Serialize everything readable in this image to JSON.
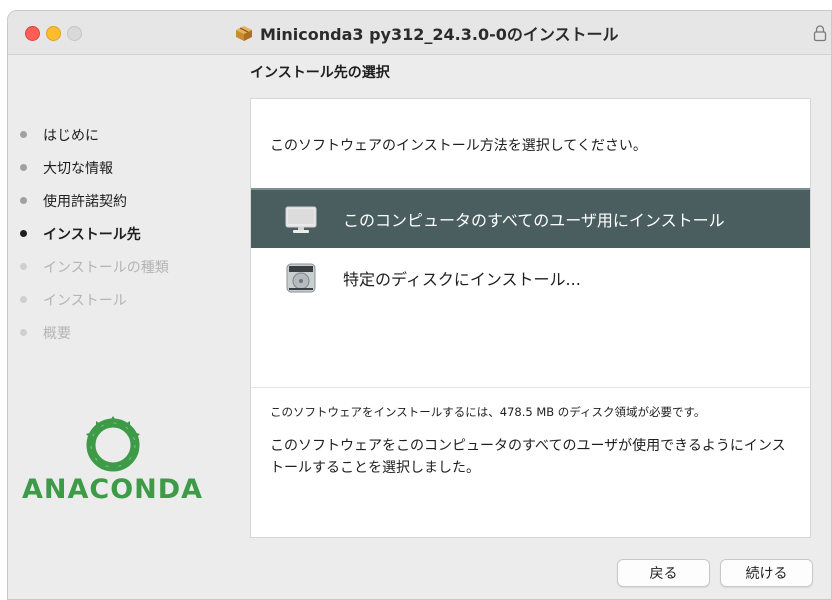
{
  "window": {
    "title": "Miniconda3 py312_24.3.0-0のインストール"
  },
  "section_heading": "インストール先の選択",
  "sidebar": {
    "steps": [
      {
        "label": "はじめに",
        "state": "done"
      },
      {
        "label": "大切な情報",
        "state": "done"
      },
      {
        "label": "使用許諾契約",
        "state": "done"
      },
      {
        "label": "インストール先",
        "state": "current"
      },
      {
        "label": "インストールの種類",
        "state": "future"
      },
      {
        "label": "インストール",
        "state": "future"
      },
      {
        "label": "概要",
        "state": "future"
      }
    ]
  },
  "logo": {
    "text": "ANACONDA",
    "color": "#3d9a47"
  },
  "panel": {
    "prompt": "このソフトウェアのインストール方法を選択してください。",
    "options": [
      {
        "label": "このコンピュータのすべてのユーザ用にインストール",
        "icon": "computer-icon",
        "selected": true
      },
      {
        "label": "特定のディスクにインストール...",
        "icon": "disk-icon",
        "selected": false
      }
    ],
    "space_note": "このソフトウェアをインストールするには、478.5 MB のディスク領域が必要です。",
    "description": "このソフトウェアをこのコンピュータのすべてのユーザが使用できるようにインストールすることを選択しました。"
  },
  "buttons": {
    "back": "戻る",
    "continue": "続ける"
  },
  "colors": {
    "selected_row": "#4b5e5f",
    "close": "#ff5f57",
    "minimize": "#febc2e"
  }
}
